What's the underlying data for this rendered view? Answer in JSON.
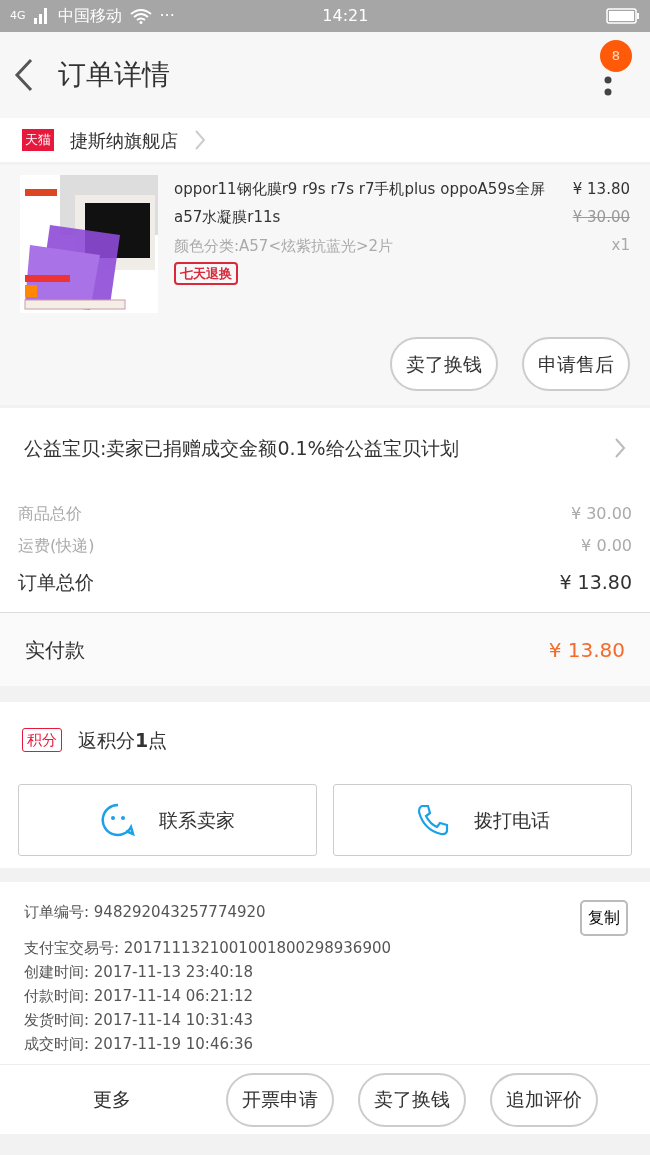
{
  "status_bar": {
    "network": "4G",
    "carrier": "中国移动",
    "dots": "···",
    "time": "14:21"
  },
  "header": {
    "title": "订单详情",
    "badge": "8"
  },
  "shop": {
    "tag": "天猫",
    "name": "捷斯纳旗舰店"
  },
  "product": {
    "image": {
      "kind": "picture"
    },
    "title": "oppor11钢化膜r9 r9s r7s r7手机plus oppoA59s全屏a57水凝膜r11s",
    "variant": "颜色分类:A57<炫紫抗蓝光>2片",
    "tag": "七天退换",
    "price": "¥ 13.80",
    "original_price": "¥ 30.00",
    "quantity": "x1",
    "buttons": [
      "卖了换钱",
      "申请售后"
    ]
  },
  "charity": {
    "text": "公益宝贝:卖家已捐赠成交金额0.1%给公益宝贝计划"
  },
  "totals": [
    {
      "label": "商品总价",
      "value": "¥ 30.00",
      "kind": "minor"
    },
    {
      "label": "运费(快递)",
      "value": "¥ 0.00",
      "kind": "minor"
    },
    {
      "label": "订单总价",
      "value": "¥ 13.80",
      "kind": "major"
    }
  ],
  "paid": {
    "label": "实付款",
    "value": "¥ 13.80"
  },
  "points": {
    "tag": "积分",
    "text": "返积分**1**点"
  },
  "contact": [
    {
      "label": "联系卖家",
      "kind": "chat"
    },
    {
      "label": "拨打电话",
      "kind": "phone"
    }
  ],
  "order_info": {
    "copy_button": "复制",
    "lines": [
      "订单编号: 948292043257774920",
      "支付宝交易号: 2017111321001001800298936900",
      "创建时间: 2017-11-13 23:40:18",
      "付款时间: 2017-11-14 06:21:12",
      "发货时间: 2017-11-14 10:31:43",
      "成交时间: 2017-11-19 10:46:36"
    ]
  },
  "bottom_bar": {
    "more": "更多",
    "buttons": [
      "开票申请",
      "卖了换钱",
      "追加评价"
    ]
  }
}
